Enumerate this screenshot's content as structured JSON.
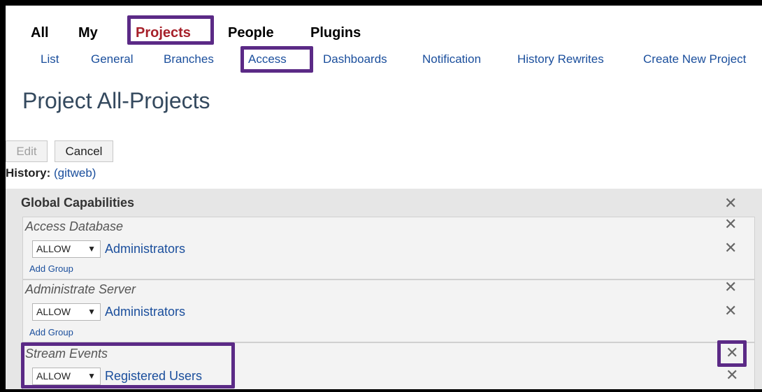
{
  "top_nav": {
    "tabs": [
      {
        "label": "All"
      },
      {
        "label": "My"
      },
      {
        "label": "Projects"
      },
      {
        "label": "People"
      },
      {
        "label": "Plugins"
      }
    ],
    "active": "Projects"
  },
  "sub_nav": {
    "items": [
      {
        "label": "List"
      },
      {
        "label": "General"
      },
      {
        "label": "Branches"
      },
      {
        "label": "Access"
      },
      {
        "label": "Dashboards"
      },
      {
        "label": "Notification"
      },
      {
        "label": "History Rewrites"
      },
      {
        "label": "Create New Project"
      }
    ],
    "active": "Access"
  },
  "page": {
    "title": "Project All-Projects"
  },
  "actions": {
    "edit_label": "Edit",
    "cancel_label": "Cancel"
  },
  "history": {
    "label": "History:",
    "link": "(gitweb)"
  },
  "global_capabilities": {
    "title": "Global Capabilities",
    "permissions": [
      {
        "name": "Access Database",
        "rules": [
          {
            "action": "ALLOW",
            "group": "Administrators"
          }
        ],
        "add_group_label": "Add Group"
      },
      {
        "name": "Administrate Server",
        "rules": [
          {
            "action": "ALLOW",
            "group": "Administrators"
          }
        ],
        "add_group_label": "Add Group"
      },
      {
        "name": "Stream Events",
        "rules": [
          {
            "action": "ALLOW",
            "group": "Registered Users"
          }
        ]
      }
    ]
  },
  "icons": {
    "close": "close-icon",
    "dropdown": "chevron-down-icon"
  },
  "colors": {
    "active_tab": "#a6202a",
    "link": "#1a4e9c",
    "highlight": "#5b2a86",
    "title": "#34495e"
  }
}
